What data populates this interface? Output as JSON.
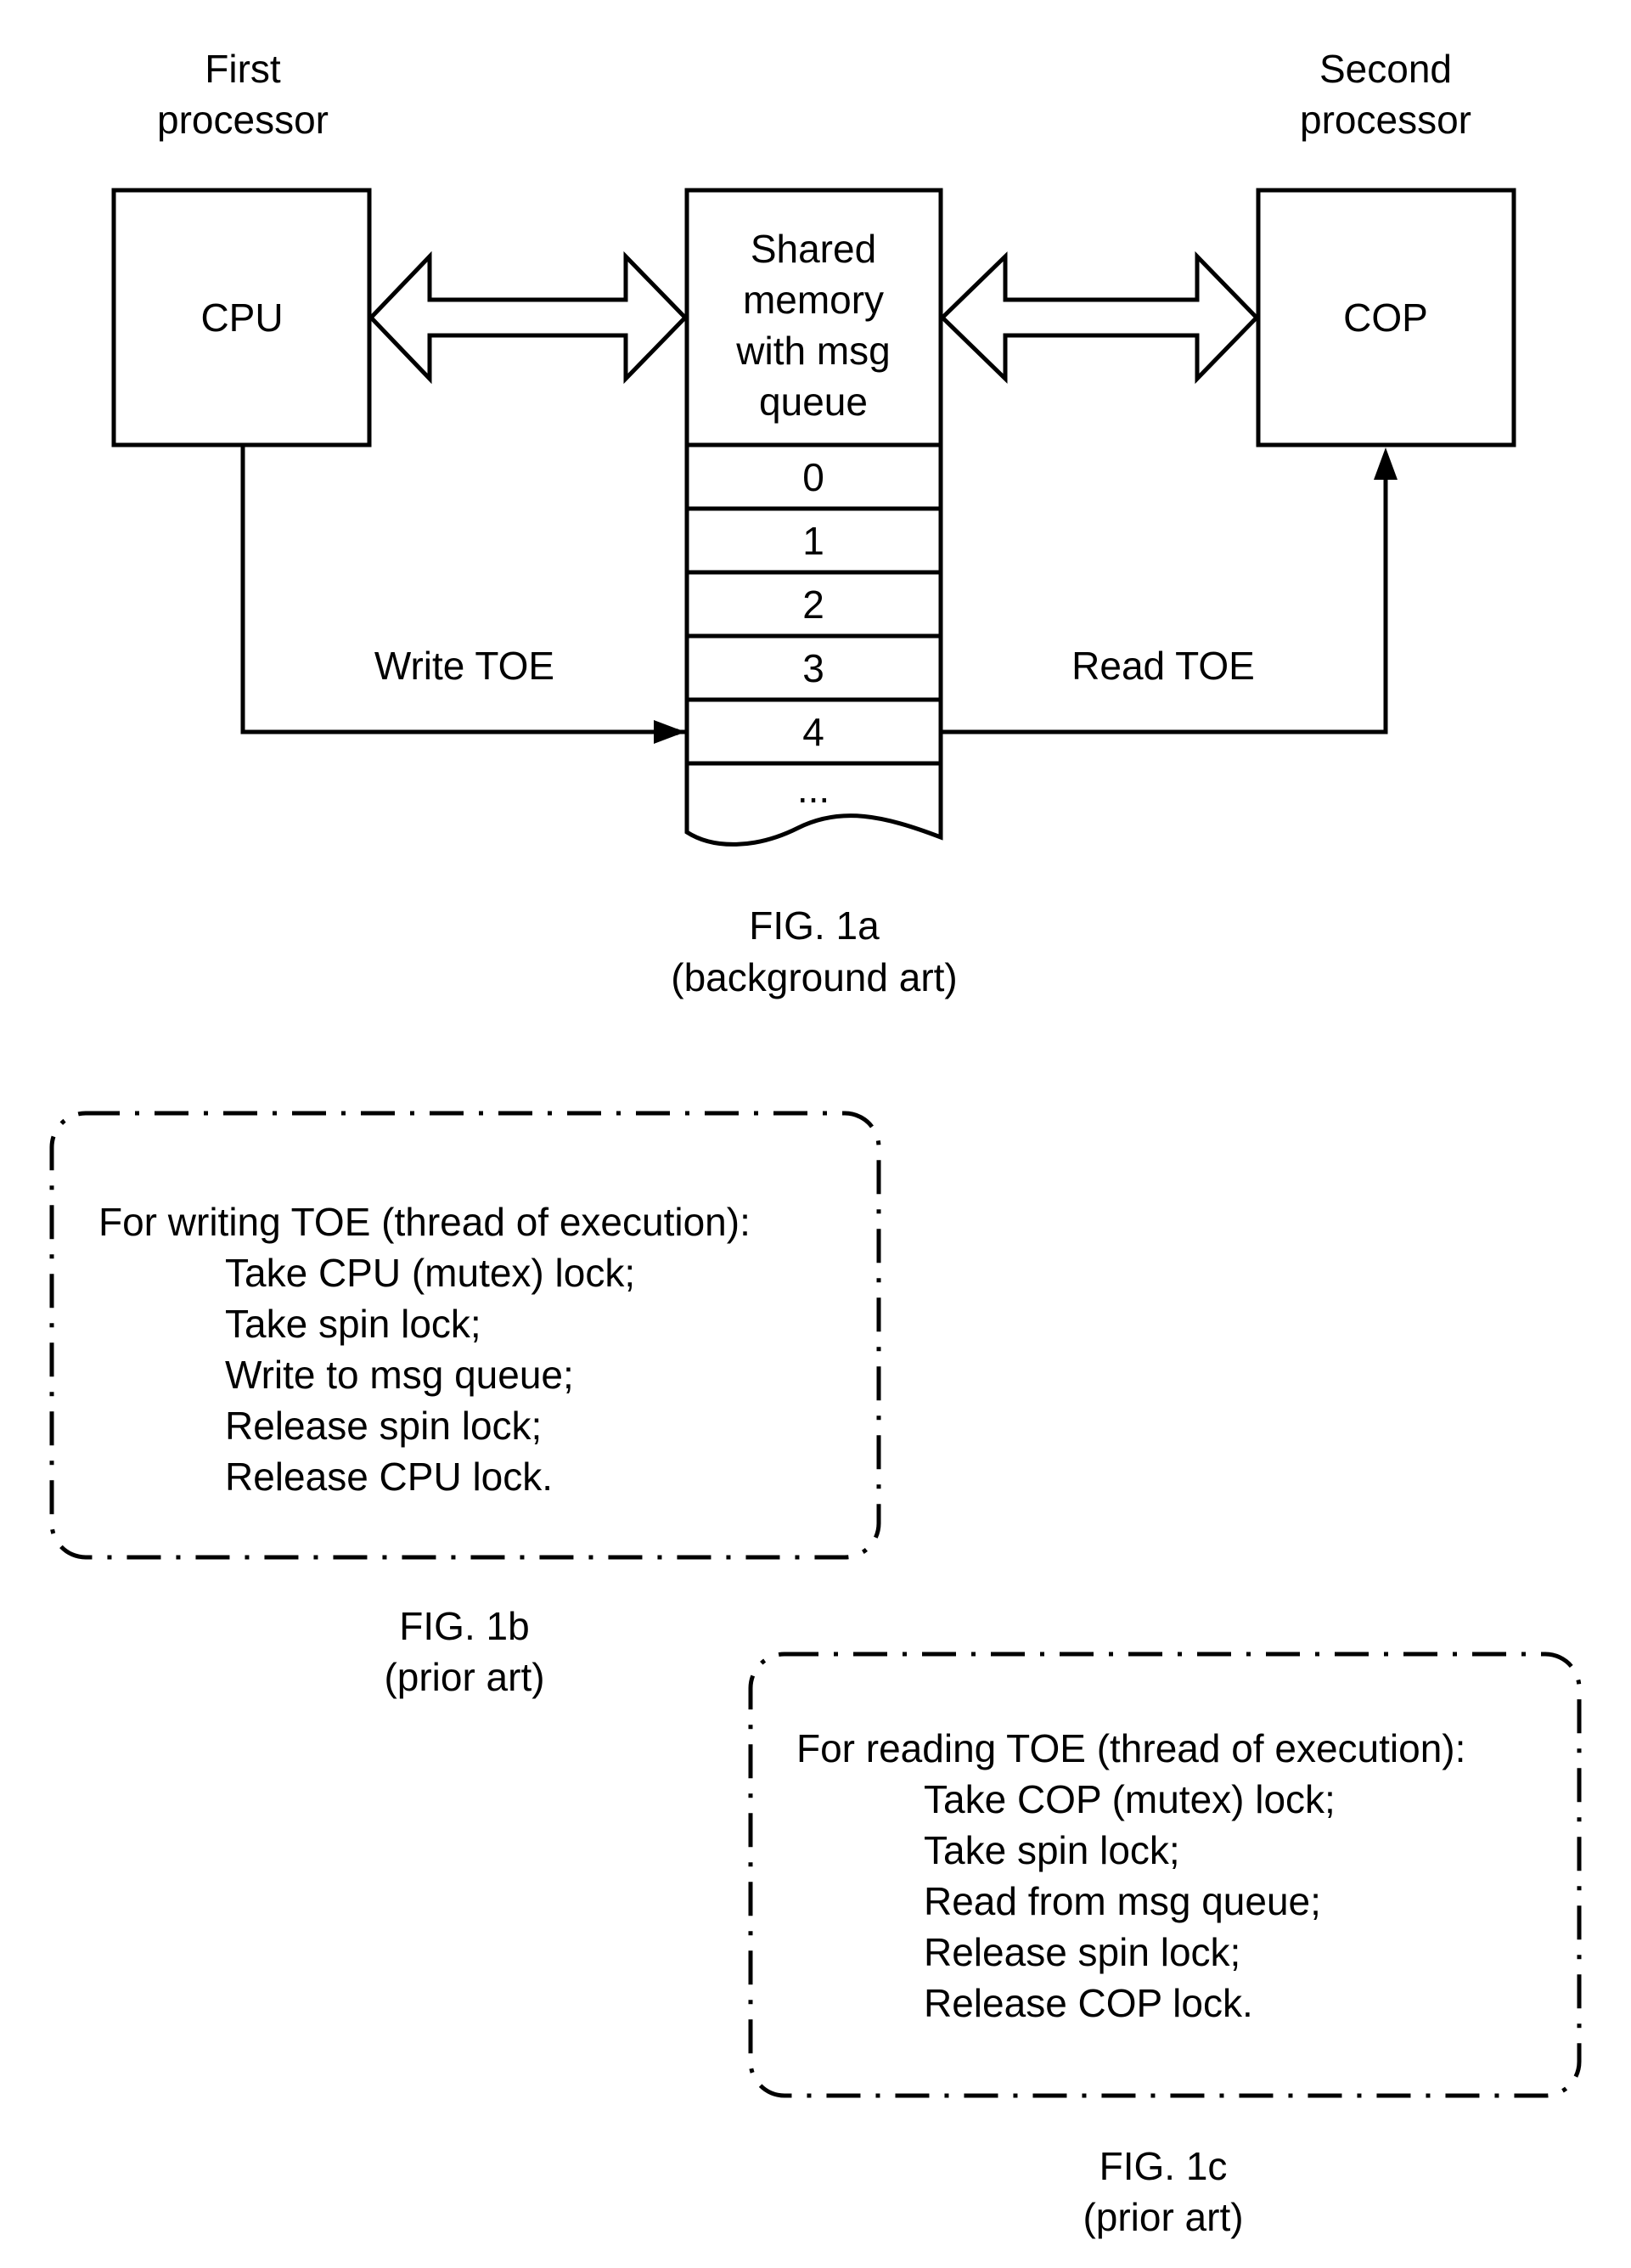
{
  "fig1a": {
    "first_processor": [
      "First",
      "processor"
    ],
    "second_processor": [
      "Second",
      "processor"
    ],
    "cpu_label": "CPU",
    "cop_label": "COP",
    "shared_memory": [
      "Shared",
      "memory",
      "with msg",
      "queue"
    ],
    "queue_slots": [
      "0",
      "1",
      "2",
      "3",
      "4",
      "..."
    ],
    "write_label": "Write TOE",
    "read_label": "Read TOE",
    "caption": [
      "FIG. 1a",
      "(background art)"
    ]
  },
  "fig1b": {
    "heading": "For writing TOE (thread of execution):",
    "steps": [
      "Take CPU (mutex) lock;",
      "Take spin lock;",
      "Write to msg queue;",
      "Release spin lock;",
      "Release CPU lock."
    ],
    "caption": [
      "FIG. 1b",
      "(prior art)"
    ]
  },
  "fig1c": {
    "heading": "For reading TOE (thread of execution):",
    "steps": [
      "Take COP (mutex) lock;",
      "Take spin lock;",
      "Read from msg queue;",
      "Release spin lock;",
      "Release COP lock."
    ],
    "caption": [
      "FIG. 1c",
      "(prior art)"
    ]
  }
}
